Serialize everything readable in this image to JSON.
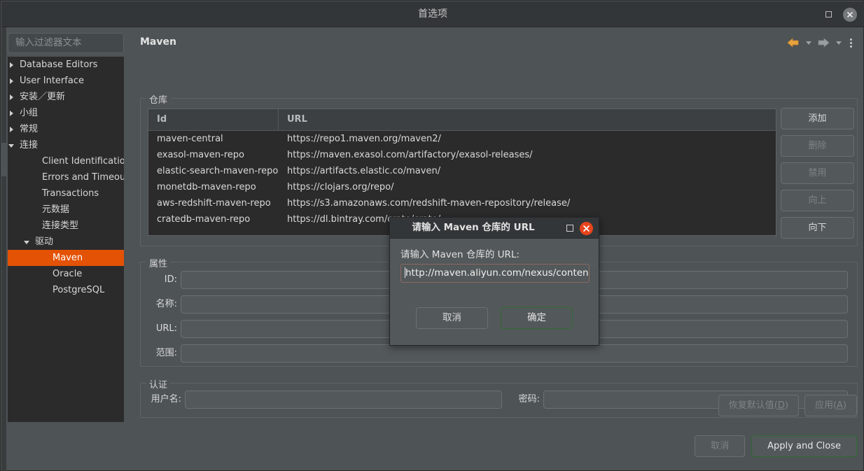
{
  "window": {
    "title": "首选项",
    "maximize_label": "maximize",
    "close_label": "close"
  },
  "sidebar": {
    "filter_placeholder": "输入过滤器文本",
    "items": [
      {
        "label": "Database Editors",
        "indent": 8,
        "twisty": "closed",
        "selected": false
      },
      {
        "label": "User Interface",
        "indent": 8,
        "twisty": "closed",
        "selected": false
      },
      {
        "label": "安装／更新",
        "indent": 8,
        "twisty": "closed",
        "selected": false
      },
      {
        "label": "小组",
        "indent": 8,
        "twisty": "closed",
        "selected": false
      },
      {
        "label": "常规",
        "indent": 8,
        "twisty": "closed",
        "selected": false
      },
      {
        "label": "连接",
        "indent": 8,
        "twisty": "open",
        "selected": false
      },
      {
        "label": "Client Identification",
        "indent": 40,
        "twisty": "none",
        "selected": false
      },
      {
        "label": "Errors and Timeouts",
        "indent": 40,
        "twisty": "none",
        "selected": false
      },
      {
        "label": "Transactions",
        "indent": 40,
        "twisty": "none",
        "selected": false
      },
      {
        "label": "元数据",
        "indent": 40,
        "twisty": "none",
        "selected": false
      },
      {
        "label": "连接类型",
        "indent": 40,
        "twisty": "none",
        "selected": false
      },
      {
        "label": "驱动",
        "indent": 30,
        "twisty": "open",
        "selected": false
      },
      {
        "label": "Maven",
        "indent": 55,
        "twisty": "none",
        "selected": true
      },
      {
        "label": "Oracle",
        "indent": 55,
        "twisty": "none",
        "selected": false
      },
      {
        "label": "PostgreSQL",
        "indent": 55,
        "twisty": "none",
        "selected": false
      }
    ]
  },
  "page": {
    "title": "Maven",
    "nav": {
      "back_icon": "arrow-left-icon",
      "back_dropdown_icon": "chevron-down-icon",
      "forward_icon": "arrow-right-icon",
      "forward_dropdown_icon": "chevron-down-icon",
      "menu_icon": "kebab-menu-icon"
    }
  },
  "repositories": {
    "legend": "仓库",
    "columns": [
      "Id",
      "URL"
    ],
    "rows": [
      {
        "id": "maven-central",
        "url": "https://repo1.maven.org/maven2/"
      },
      {
        "id": "exasol-maven-repo",
        "url": "https://maven.exasol.com/artifactory/exasol-releases/"
      },
      {
        "id": "elastic-search-maven-repo",
        "url": "https://artifacts.elastic.co/maven/"
      },
      {
        "id": "monetdb-maven-repo",
        "url": "https://clojars.org/repo/"
      },
      {
        "id": "aws-redshift-maven-repo",
        "url": "https://s3.amazonaws.com/redshift-maven-repository/release/"
      },
      {
        "id": "cratedb-maven-repo",
        "url": "https://dl.bintray.com/crate/crate/"
      }
    ],
    "buttons": [
      {
        "label": "添加",
        "disabled": false
      },
      {
        "label": "删除",
        "disabled": true
      },
      {
        "label": "禁用",
        "disabled": true
      },
      {
        "label": "向上",
        "disabled": true
      },
      {
        "label": "向下",
        "disabled": false
      }
    ]
  },
  "properties": {
    "legend": "属性",
    "fields": [
      {
        "label": "ID:",
        "value": ""
      },
      {
        "label": "名称:",
        "value": ""
      },
      {
        "label": "URL:",
        "value": ""
      },
      {
        "label": "范围:",
        "value": ""
      }
    ]
  },
  "authentication": {
    "legend": "认证",
    "username_label": "用户名:",
    "username_value": "",
    "password_label": "密码:",
    "password_value": ""
  },
  "footer": {
    "restore_defaults": "恢复默认值(D)",
    "restore_defaults_mnemonic": "D",
    "apply": "应用(A)",
    "apply_mnemonic": "A",
    "cancel": "取消",
    "apply_and_close": "Apply and Close"
  },
  "dialog": {
    "title": "请输入 Maven 仓库的 URL",
    "prompt": "请输入 Maven 仓库的 URL:",
    "input_value": "http://maven.aliyun.com/nexus/content",
    "cancel_label": "取消",
    "ok_label": "确定",
    "maximize_icon": "maximize-icon",
    "close_icon": "close-icon"
  },
  "colors": {
    "accent_selection": "#e35205",
    "window_bg": "#4e5355",
    "panel_dark": "#2b2b2b",
    "titlebar": "#333638",
    "dialog_close": "#e8441c",
    "nav_back": "#e8a33d",
    "default_btn_border": "#2f6b33"
  }
}
